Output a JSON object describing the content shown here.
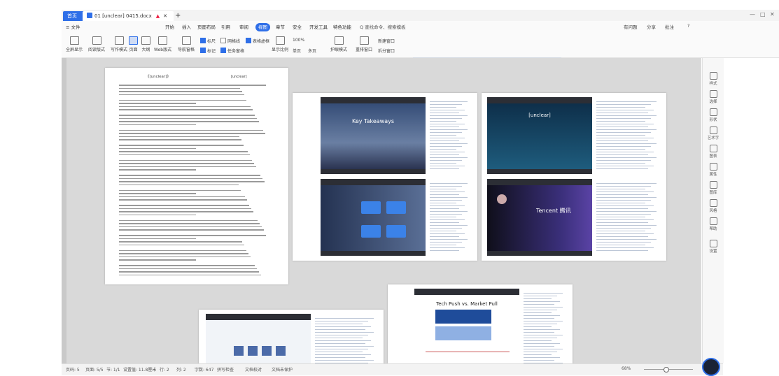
{
  "titlebar": {
    "home_tab": "首页",
    "doc_tab": "01 [unclear] 0415.docx",
    "add_tab": "+",
    "window_buttons": [
      "—",
      "□",
      "✕"
    ]
  },
  "menubar": {
    "items": [
      "≡ 文件",
      "开始",
      "插入",
      "页面布局",
      "引用",
      "审阅",
      "视图",
      "章节",
      "安全",
      "开发工具",
      "特色功能"
    ],
    "active": "视图",
    "search": "Q 查找命令、搜索模板",
    "right": [
      "有问题",
      "分享",
      "批注",
      "?"
    ]
  },
  "toolbar": {
    "views": [
      "全屏显示",
      "阅读版式",
      "写作模式",
      "页面",
      "大纲",
      "Web版式"
    ],
    "selected_view": "页面",
    "nav_pane": "导航窗格",
    "checks": [
      {
        "label": "标尺",
        "on": true
      },
      {
        "label": "网格线",
        "on": false
      },
      {
        "label": "表格虚框",
        "on": true
      },
      {
        "label": "标记",
        "on": true
      },
      {
        "label": "任务窗格",
        "on": true
      }
    ],
    "zoom_group": [
      "显示比例",
      "100%",
      "单页",
      "多页"
    ],
    "eye": "护眼模式",
    "window_group": [
      "重排窗口",
      "新建窗口",
      "拆分窗口"
    ]
  },
  "pages": {
    "page1_header": "《[unclear]》",
    "page1_meta": "[unclear]",
    "slide_titles": [
      "Key Takeaways",
      "[unclear]",
      "Tech Push vs. Market Pull"
    ],
    "slide_logo": "Tencent 腾讯"
  },
  "rightpanel": {
    "items": [
      "样式",
      "选择",
      "形状",
      "艺术字",
      "图表",
      "属性",
      "图库",
      "风格",
      "帮助",
      "设置"
    ]
  },
  "statusbar": {
    "page": "页码: 5",
    "pages": "页面: 5/5",
    "section": "节: 1/1",
    "setting": "设置值: 11.8厘米",
    "row": "行: 2",
    "col": "列: 2",
    "words": "字数: 647",
    "spell": "拼写检查",
    "check": "文档校对",
    "protect": "文档未保护",
    "zoom": "68%"
  }
}
